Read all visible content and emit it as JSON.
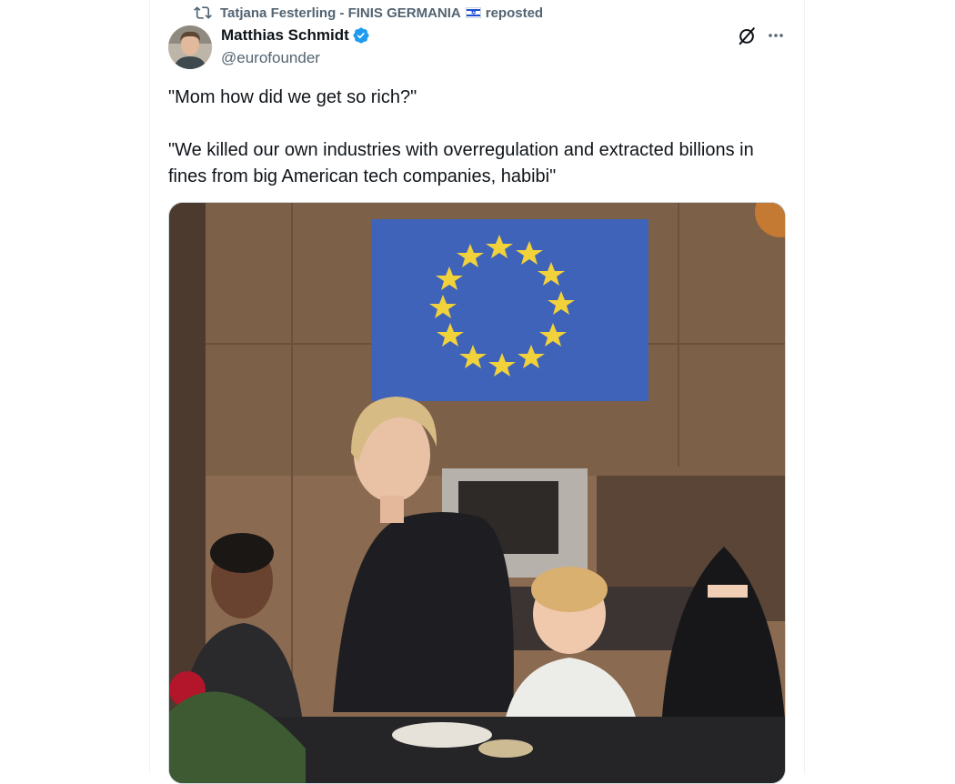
{
  "repost": {
    "reposter_name": "Tatjana Festerling - FINIS GERMANIA",
    "reposted_label": "reposted",
    "flag_icon": "israel-flag-emoji"
  },
  "author": {
    "display_name": "Matthias Schmidt",
    "handle": "@eurofounder",
    "verified": true,
    "verified_color": "#1d9bf0"
  },
  "tweet": {
    "text": "\"Mom how did we get so rich?\"\n\n\"We killed our own industries with overregulation and extracted billions in fines from big American tech companies, habibi\""
  },
  "icons": [
    "repost-icon",
    "verified-badge-icon",
    "grok-icon",
    "more-icon"
  ],
  "colors": {
    "text": "#0f1419",
    "secondary": "#536471",
    "border": "#eff3f4",
    "accent": "#1d9bf0"
  }
}
